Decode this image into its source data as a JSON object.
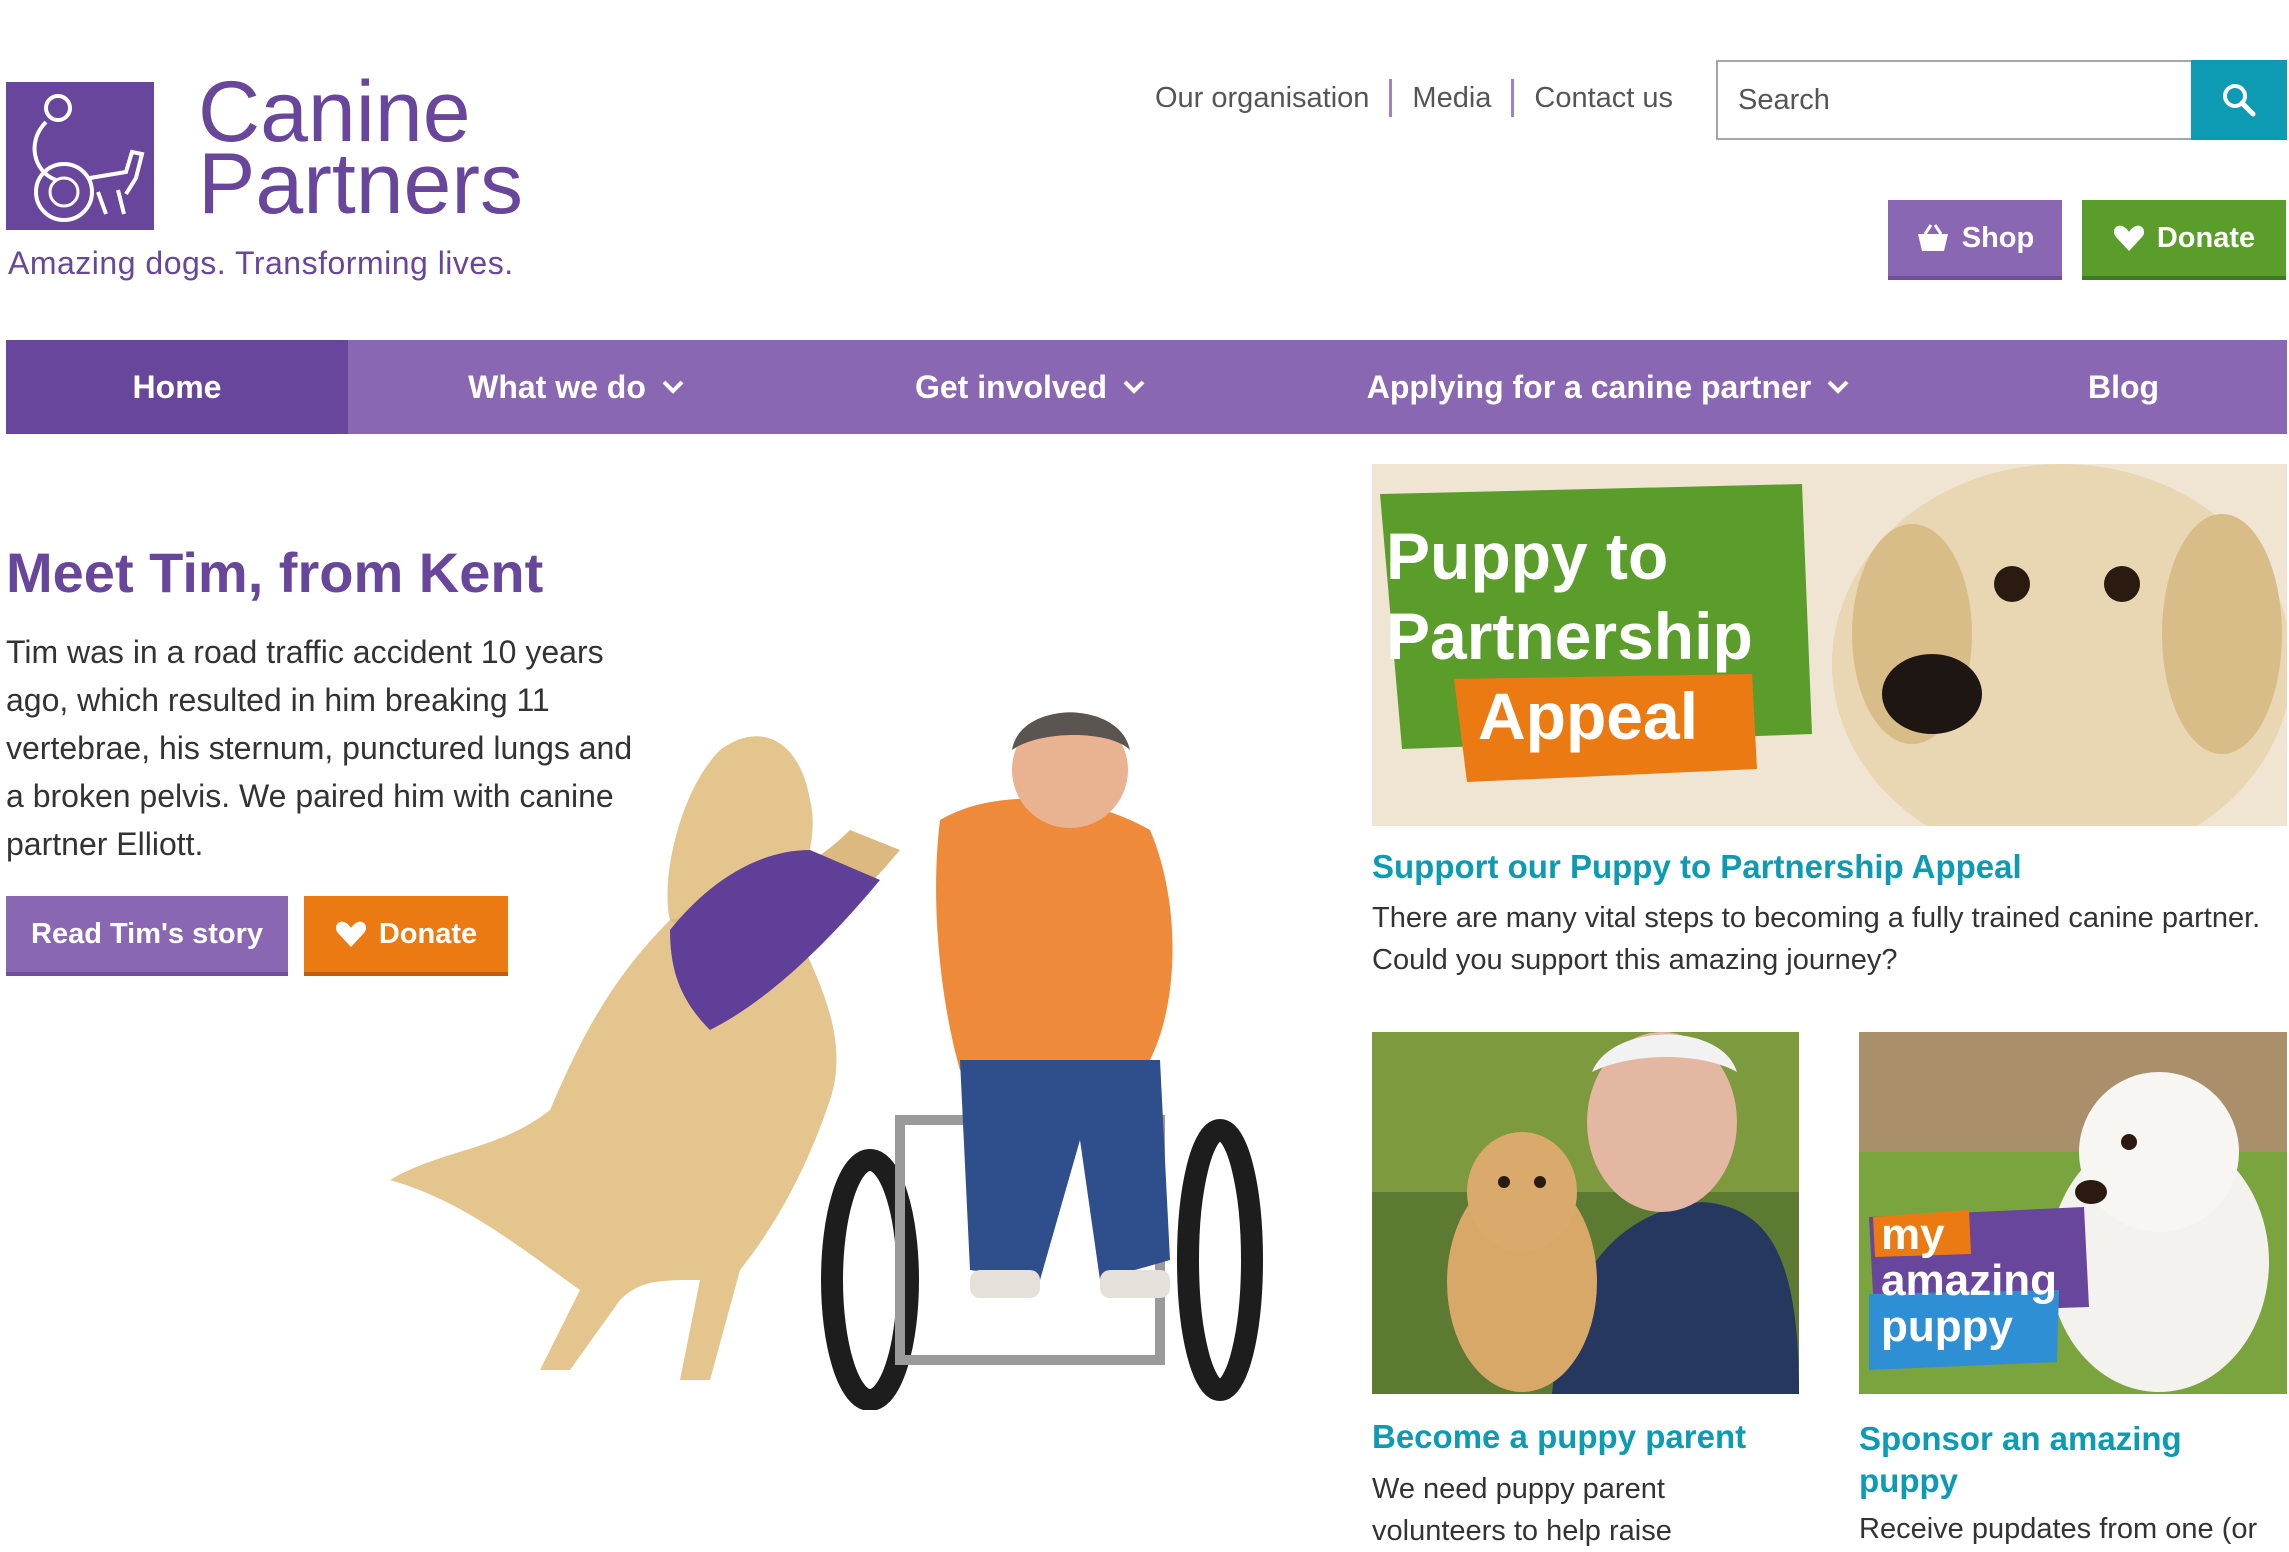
{
  "logo": {
    "line1": "Canine",
    "line2": "Partners",
    "tagline": "Amazing dogs. Transforming lives."
  },
  "utility_nav": [
    "Our organisation",
    "Media",
    "Contact us"
  ],
  "search": {
    "placeholder": "Search"
  },
  "header_buttons": {
    "shop": "Shop",
    "donate": "Donate"
  },
  "main_nav": [
    {
      "label": "Home",
      "active": true,
      "dropdown": false
    },
    {
      "label": "What we do",
      "active": false,
      "dropdown": true
    },
    {
      "label": "Get involved",
      "active": false,
      "dropdown": true
    },
    {
      "label": "Applying for a canine partner",
      "active": false,
      "dropdown": true
    },
    {
      "label": "Blog",
      "active": false,
      "dropdown": false
    }
  ],
  "hero": {
    "title": "Meet Tim, from Kent",
    "text": "Tim was in a road traffic accident 10 years ago, which resulted in him breaking 11 vertebrae, his sternum, punctured lungs and a broken pelvis. We paired him with canine partner Elliott.",
    "read_button": "Read Tim's story",
    "donate_button": "Donate"
  },
  "appeal": {
    "banner_line1": "Puppy to",
    "banner_line2": "Partnership",
    "banner_line3": "Appeal",
    "title": "Support our Puppy to Partnership Appeal",
    "text": "There are many vital steps to becoming a fully trained canine partner. Could you support this amazing journey?"
  },
  "puppy_parent": {
    "title": "Become a puppy parent",
    "text": "We need puppy parent volunteers to help raise"
  },
  "sponsor": {
    "badge_line1": "my",
    "badge_line2": "amazing",
    "badge_line3": "puppy",
    "title": "Sponsor an amazing puppy",
    "text": "Receive pupdates from one (or"
  },
  "colors": {
    "brand_purple": "#67469b",
    "nav_purple": "#8967b3",
    "teal": "#0d9bb4",
    "green": "#5b9d2a",
    "orange": "#ec7a12"
  }
}
